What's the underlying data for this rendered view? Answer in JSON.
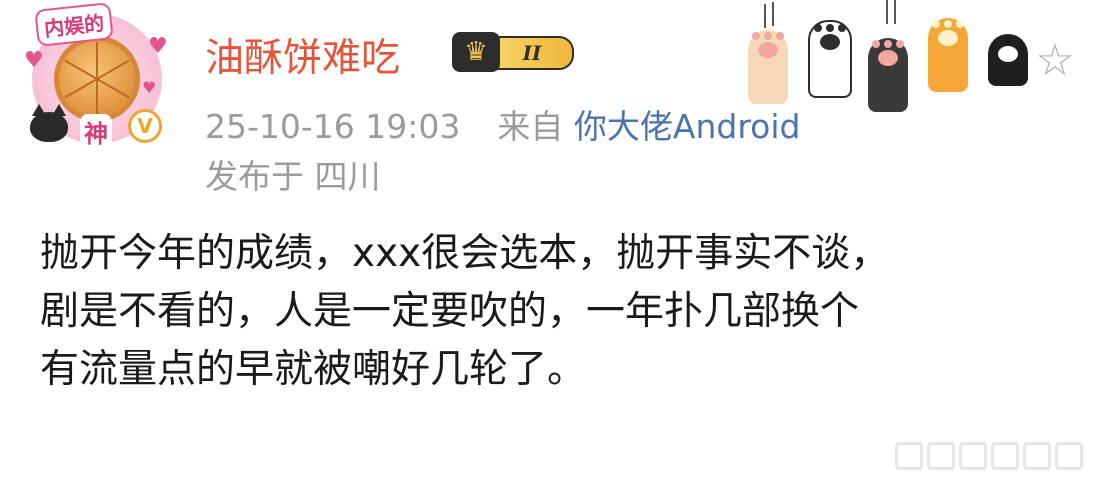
{
  "user": {
    "name": "油酥饼难吃",
    "level_badge": "II",
    "avatar_caption_top": "内娱的",
    "avatar_caption_bottom": "神",
    "verified_mark": "V"
  },
  "post": {
    "date": "25-10-16 19:03",
    "source_prefix": "来自",
    "source": "你大佬Android",
    "location": "发布于 四川",
    "lines": [
      "抛开今年的成绩，xxx很会选本，抛开事实不谈，",
      "剧是不看的，人是一定要吹的，一年扑几部换个",
      "有流量点的早就被嘲好几轮了。"
    ],
    "next_line_fragment": "··· ···"
  },
  "colors": {
    "username": "#e5553b",
    "source_link": "#4a74ad",
    "meta_gray": "#9b9b9b",
    "verified": "#f0a62a",
    "badge_gold": "#f0b83b"
  },
  "icons": {
    "crown": "crown-icon",
    "star": "star-icon",
    "decoration": "cat-paw-icon"
  }
}
